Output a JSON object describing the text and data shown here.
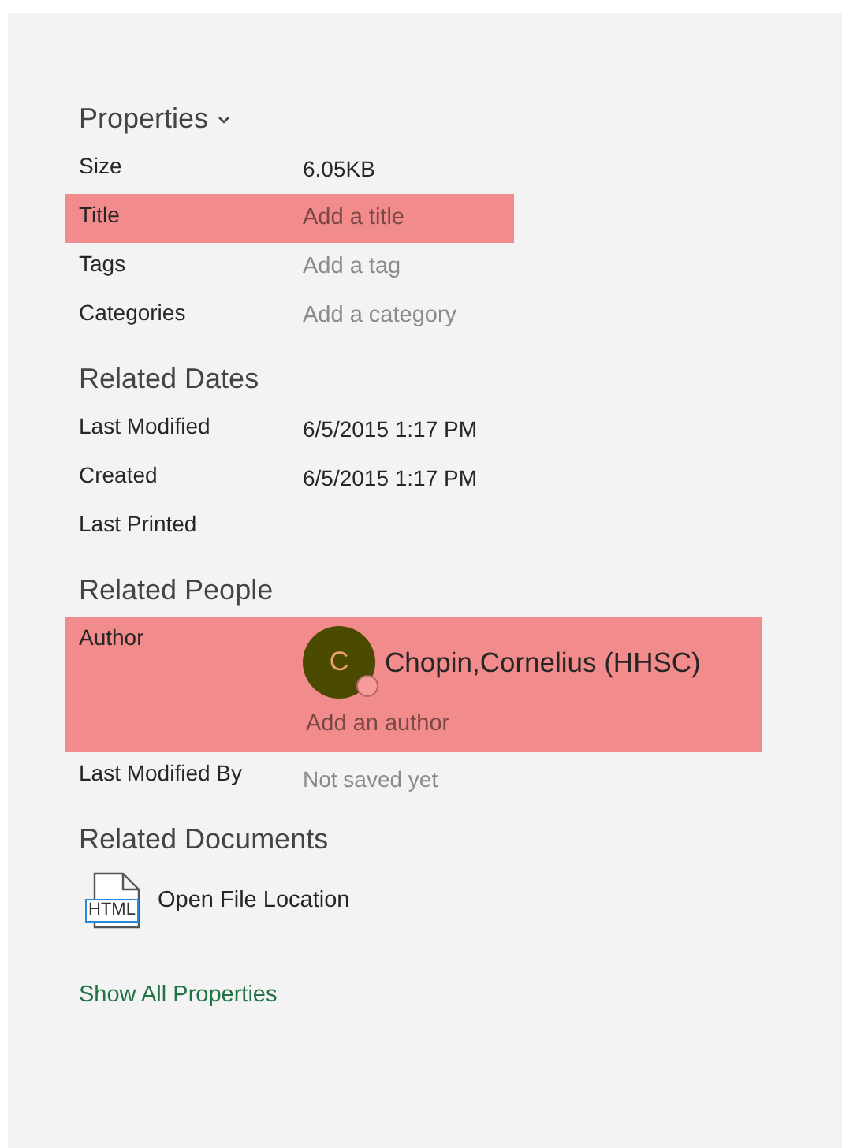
{
  "sections": [
    {
      "title": "Properties",
      "collapsible": true,
      "rows": [
        {
          "kind": "value",
          "label": "Size",
          "value": "6.05KB",
          "highlighted": false
        },
        {
          "kind": "field",
          "label": "Title",
          "placeholder": "Add a title",
          "highlighted": true
        },
        {
          "kind": "field",
          "label": "Tags",
          "placeholder": "Add a tag",
          "highlighted": false
        },
        {
          "kind": "field",
          "label": "Categories",
          "placeholder": "Add a category",
          "highlighted": false
        }
      ]
    },
    {
      "title": "Related Dates",
      "collapsible": false,
      "rows": [
        {
          "kind": "value",
          "label": "Last Modified",
          "value": "6/5/2015 1:17 PM",
          "highlighted": false
        },
        {
          "kind": "value",
          "label": "Created",
          "value": "6/5/2015 1:17 PM",
          "highlighted": false
        },
        {
          "kind": "empty",
          "label": "Last Printed",
          "highlighted": false
        }
      ]
    },
    {
      "title": "Related People",
      "collapsible": false,
      "rows": [
        {
          "kind": "people",
          "label": "Author",
          "people": [
            {
              "initial": "C",
              "name": "Chopin,Cornelius (HHSC)"
            }
          ],
          "placeholder": "Add an author",
          "highlighted": true
        },
        {
          "kind": "note",
          "label": "Last Modified By",
          "value": "Not saved yet",
          "highlighted": false
        }
      ]
    },
    {
      "title": "Related Documents",
      "collapsible": false,
      "documents": [
        {
          "icon_label": "HTML",
          "label": "Open File Location"
        }
      ]
    }
  ],
  "footer_link": "Show All Properties"
}
